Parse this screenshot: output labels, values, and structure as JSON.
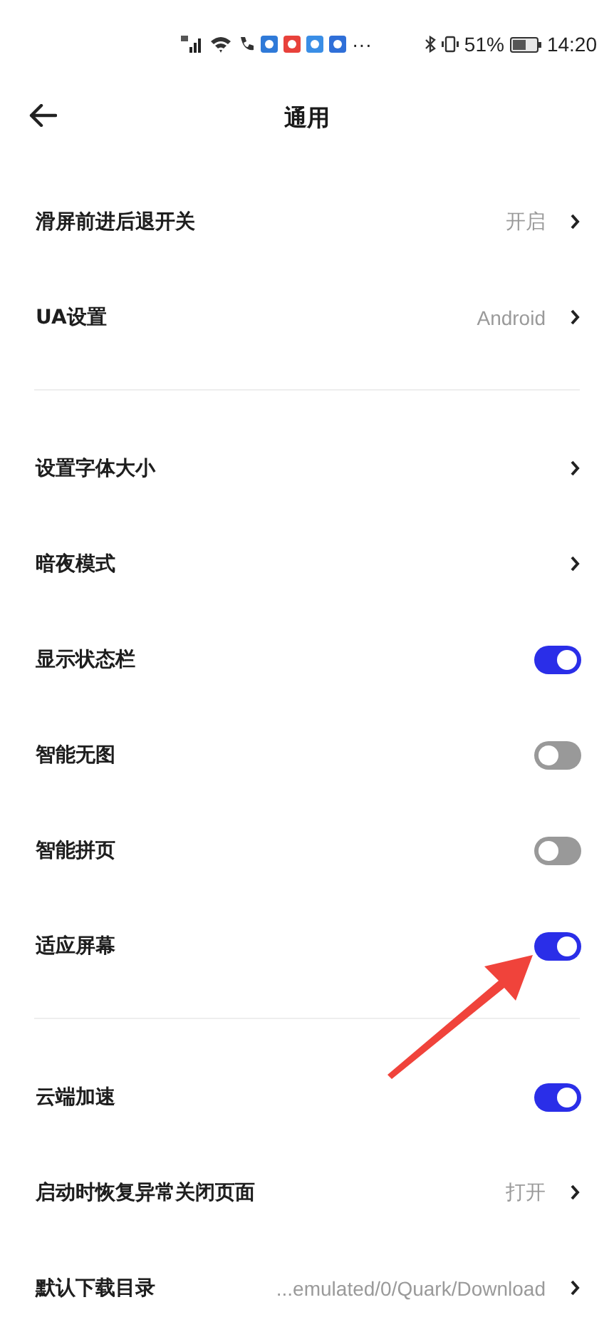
{
  "status_bar": {
    "overflow": "···",
    "battery_percent": "51%",
    "time": "14:20"
  },
  "header": {
    "title": "通用"
  },
  "sections": [
    {
      "rows": [
        {
          "kind": "link",
          "label": "滑屏前进后退开关",
          "value": "开启"
        },
        {
          "kind": "link",
          "label": "UA设置",
          "value": "Android"
        }
      ]
    },
    {
      "rows": [
        {
          "kind": "link",
          "label": "设置字体大小"
        },
        {
          "kind": "link",
          "label": "暗夜模式"
        },
        {
          "kind": "toggle",
          "label": "显示状态栏",
          "on": true
        },
        {
          "kind": "toggle",
          "label": "智能无图",
          "on": false
        },
        {
          "kind": "toggle",
          "label": "智能拼页",
          "on": false
        },
        {
          "kind": "toggle",
          "label": "适应屏幕",
          "on": true
        }
      ]
    },
    {
      "rows": [
        {
          "kind": "toggle",
          "label": "云端加速",
          "on": true
        },
        {
          "kind": "link",
          "label": "启动时恢复异常关闭页面",
          "value": "打开"
        },
        {
          "kind": "link",
          "label": "默认下载目录",
          "value": "...emulated/0/Quark/Download"
        }
      ]
    }
  ]
}
